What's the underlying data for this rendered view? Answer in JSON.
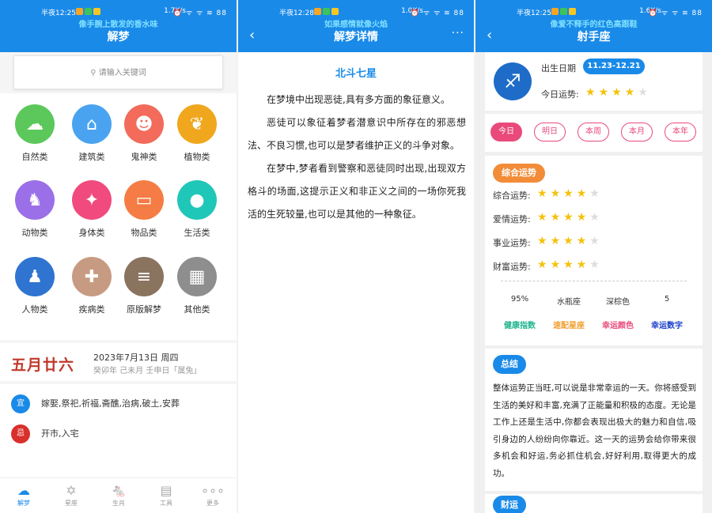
{
  "panel1": {
    "status": {
      "time": "半夜12:25",
      "speed": "1.7K/s",
      "signal": "⏰ ᯤ ᯤ ≋ 88"
    },
    "marquee": "像手腕上散发的香水味",
    "title": "解梦",
    "search_placeholder": "请输入关键词",
    "categories": [
      {
        "label": "自然类",
        "icon": "cloud-icon",
        "color": "#5cc85c",
        "glyph": "☁"
      },
      {
        "label": "建筑类",
        "icon": "house-icon",
        "color": "#4aa3f0",
        "glyph": "⌂"
      },
      {
        "label": "鬼神类",
        "icon": "person-icon",
        "color": "#f26b5b",
        "glyph": "☻"
      },
      {
        "label": "植物类",
        "icon": "leaf-icon",
        "color": "#f0a71e",
        "glyph": "❦"
      },
      {
        "label": "动物类",
        "icon": "rabbit-icon",
        "color": "#9b6fe8",
        "glyph": "♞"
      },
      {
        "label": "身体类",
        "icon": "running-icon",
        "color": "#f04a7e",
        "glyph": "✦"
      },
      {
        "label": "物品类",
        "icon": "bag-icon",
        "color": "#f57c45",
        "glyph": "▭"
      },
      {
        "label": "生活类",
        "icon": "drop-icon",
        "color": "#1fc7b8",
        "glyph": "●"
      },
      {
        "label": "人物类",
        "icon": "user-icon",
        "color": "#2f74d0",
        "glyph": "♟"
      },
      {
        "label": "疾病类",
        "icon": "pill-icon",
        "color": "#c79b82",
        "glyph": "✚"
      },
      {
        "label": "原版解梦",
        "icon": "document-icon",
        "color": "#8a7460",
        "glyph": "≡"
      },
      {
        "label": "其他类",
        "icon": "apps-icon",
        "color": "#8e8e8e",
        "glyph": "▦"
      }
    ],
    "calendar": {
      "lunar": "五月廿六",
      "date": "2023年7月13日  周四",
      "ganzhi": "癸卯年  己未月  壬申日「属兔」"
    },
    "yi": {
      "mark": "宜",
      "text": "嫁娶,祭祀,祈福,斋醮,治病,破土,安葬",
      "color": "#1a8ae8"
    },
    "ji": {
      "mark": "忌",
      "text": "开市,入宅",
      "color": "#d9302c"
    },
    "tabs": [
      {
        "label": "解梦",
        "icon": "cloud-icon",
        "glyph": "☁"
      },
      {
        "label": "星座",
        "icon": "star-of-david-icon",
        "glyph": "✡"
      },
      {
        "label": "生肖",
        "icon": "rat-icon",
        "glyph": "🐁"
      },
      {
        "label": "工具",
        "icon": "calendar-icon",
        "glyph": "▤"
      },
      {
        "label": "更多",
        "icon": "more-dots-icon",
        "glyph": "∘∘∘"
      }
    ]
  },
  "panel2": {
    "status": {
      "time": "半夜12:28",
      "speed": "1.0K/s",
      "signal": "⏰ ᯤ ᯤ ≋ 88"
    },
    "marquee": "如果感情就像火焰",
    "title": "解梦详情",
    "back_glyph": "‹",
    "more_glyph": "···",
    "dream_title": "北斗七星",
    "paragraphs": [
      "在梦境中出现恶徒,具有多方面的象征意义。",
      "恶徒可以象征着梦者潜意识中所存在的邪恶想法、不良习惯,也可以是梦者维护正义的斗争对象。",
      "在梦中,梦者看到警察和恶徒同时出现,出现双方格斗的场面,这提示正义和非正义之间的一场你死我活的生死较量,也可以是其他的一种象征。"
    ]
  },
  "panel3": {
    "status": {
      "time": "半夜12:25",
      "speed": "1.6K/s",
      "signal": "⏰ ᯤ ᯤ ≋ 88"
    },
    "marquee": "像爱不释手的红色高跟鞋",
    "title": "射手座",
    "back_glyph": "‹",
    "zodiac_glyph": "♐",
    "birth_label": "出生日期",
    "birth_range": "11.23-12.21",
    "today_label": "今日运势:",
    "today_stars": 4,
    "period_tabs": [
      "今日",
      "明日",
      "本周",
      "本月",
      "本年"
    ],
    "overall_tag": "综合运势",
    "fortunes": [
      {
        "label": "综合运势:",
        "stars": 4
      },
      {
        "label": "爱情运势:",
        "stars": 4
      },
      {
        "label": "事业运势:",
        "stars": 4
      },
      {
        "label": "财富运势:",
        "stars": 4
      }
    ],
    "stats": [
      {
        "value": "95%",
        "label": "健康指数",
        "color": "#1fb58f"
      },
      {
        "value": "水瓶座",
        "label": "速配星座",
        "color": "#f0a030"
      },
      {
        "value": "深棕色",
        "label": "幸运颜色",
        "color": "#e94a7b"
      },
      {
        "value": "5",
        "label": "幸运数字",
        "color": "#1a3fc8"
      }
    ],
    "summary_tag": "总结",
    "summary": "整体运势正当旺,可以说是非常幸运的一天。你将感受到生活的美好和丰富,充满了正能量和积极的态度。无论是工作上还是生活中,你都会表现出极大的魅力和自信,吸引身边的人纷纷向你靠近。这一天的运势会给你带来很多机会和好运,务必抓住机会,好好利用,取得更大的成功。",
    "wealth_tag": "财运",
    "colors": {
      "primary": "#1a8ae8",
      "pink": "#e94a7b",
      "orange": "#f28c38",
      "star": "#f4c20d"
    }
  }
}
